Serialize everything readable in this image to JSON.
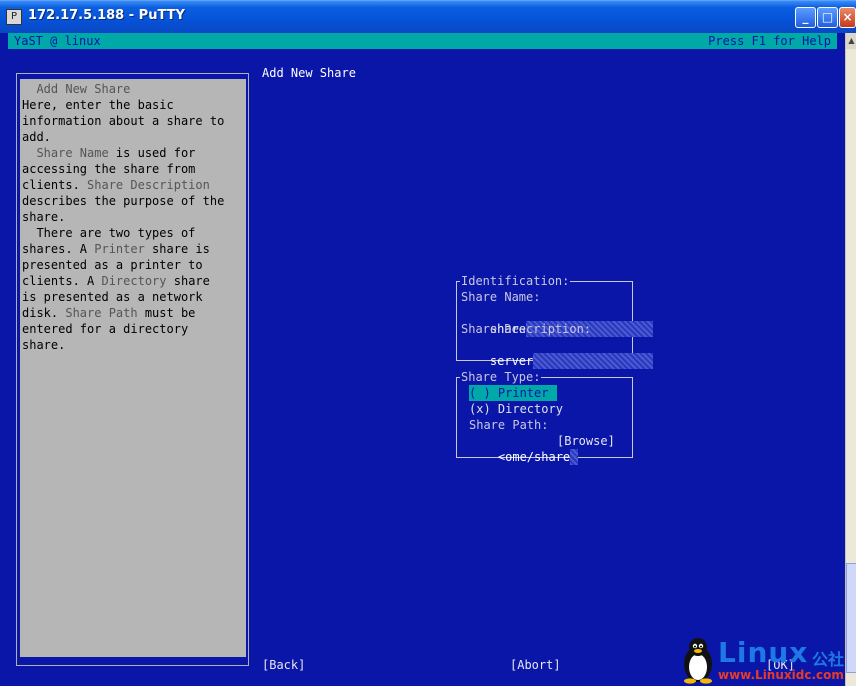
{
  "window": {
    "title": "172.17.5.188 - PuTTY",
    "icon_label": "P"
  },
  "terminal": {
    "top_left": "YaST @ linux",
    "top_right": "Press F1 for Help",
    "main_title": "Add New Share"
  },
  "help": {
    "lines": [
      [
        {
          "t": "  Add New Share",
          "h": true
        }
      ],
      [
        {
          "t": "Here, enter the basic"
        }
      ],
      [
        {
          "t": "information about a share to"
        }
      ],
      [
        {
          "t": "add."
        }
      ],
      [
        {
          "t": "  "
        },
        {
          "t": "Share Name",
          "h": true
        },
        {
          "t": " is used for"
        }
      ],
      [
        {
          "t": "accessing the share from"
        }
      ],
      [
        {
          "t": "clients. "
        },
        {
          "t": "Share Description",
          "h": true
        }
      ],
      [
        {
          "t": "describes the purpose of the"
        }
      ],
      [
        {
          "t": "share."
        }
      ],
      [
        {
          "t": "  There are two types of"
        }
      ],
      [
        {
          "t": "shares. A "
        },
        {
          "t": "Printer",
          "h": true
        },
        {
          "t": " share is"
        }
      ],
      [
        {
          "t": "presented as a printer to"
        }
      ],
      [
        {
          "t": "clients. A "
        },
        {
          "t": "Directory",
          "h": true
        },
        {
          "t": " share"
        }
      ],
      [
        {
          "t": "is presented as a network"
        }
      ],
      [
        {
          "t": "disk. "
        },
        {
          "t": "Share Path",
          "h": true
        },
        {
          "t": " must be"
        }
      ],
      [
        {
          "t": "entered for a directory"
        }
      ],
      [
        {
          "t": "share."
        }
      ]
    ]
  },
  "identification": {
    "legend": "Identification:",
    "share_name_label": "Share Name:",
    "share_name_value": "share",
    "share_desc_label": "Share Description:",
    "share_desc_value": "server"
  },
  "share_type": {
    "legend": "Share Type:",
    "printer_option": "( ) Printer",
    "directory_option": "(x) Directory",
    "share_path_label": "Share Path:",
    "share_path_value": "<ome/share",
    "browse_label": "[Browse]"
  },
  "buttons": {
    "back": "[Back]",
    "abort": "[Abort]",
    "ok": "[OK]"
  },
  "watermark": {
    "brand": "Linux",
    "cn": "公社",
    "url": "www.Linuxidc.com"
  },
  "colors": {
    "background": "#0a16a8",
    "accent_cyan": "#00a8a8",
    "help_bg": "#b6b6b6"
  }
}
